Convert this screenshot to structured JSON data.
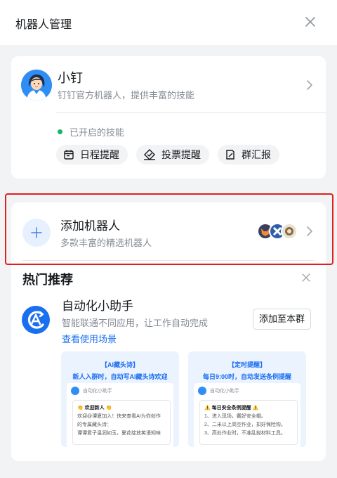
{
  "header": {
    "title": "机器人管理"
  },
  "bot": {
    "name": "小钉",
    "description": "钉钉官方机器人，提供丰富的技能",
    "skills_status": "已开启的技能",
    "skills": [
      {
        "label": "日程提醒",
        "icon": "calendar-icon"
      },
      {
        "label": "投票提醒",
        "icon": "vote-icon"
      },
      {
        "label": "群汇报",
        "icon": "report-icon"
      }
    ]
  },
  "add_robot": {
    "title": "添加机器人",
    "description": "多款丰富的精选机器人"
  },
  "hot": {
    "title": "热门推荐",
    "item": {
      "title": "自动化小助手",
      "description": "智能联通不同应用，让工作自动完成",
      "link": "查看使用场景",
      "button": "添加至本群"
    },
    "previews": [
      {
        "tag": "【AI藏头诗】",
        "subtitle": "新人入群时，自动写AI藏头诗欢迎",
        "bot": "自动化小助手",
        "lines": [
          "👏 欢迎新人 👏",
          "欢迎@谭夏加入！快来查看AI为你创作",
          "的专属藏头诗：",
          "谭谭君子温润如玉，夏花绽放笑语知味"
        ]
      },
      {
        "tag": "【定时提醒】",
        "subtitle": "每日9:00时，自动发送条例提醒",
        "bot": "自动化小助手",
        "lines": [
          "⚠️ 每日安全条例提醒 ⚠️",
          "1、进入现场，戴好安全帽。",
          "2、二米以上高空作业，扣好保险钩。",
          "3、高处作业时，不准乱抛材料工具。"
        ]
      }
    ]
  },
  "colors": {
    "accent": "#1a6ef0",
    "status_green": "#18b46b",
    "highlight": "#e02020"
  }
}
